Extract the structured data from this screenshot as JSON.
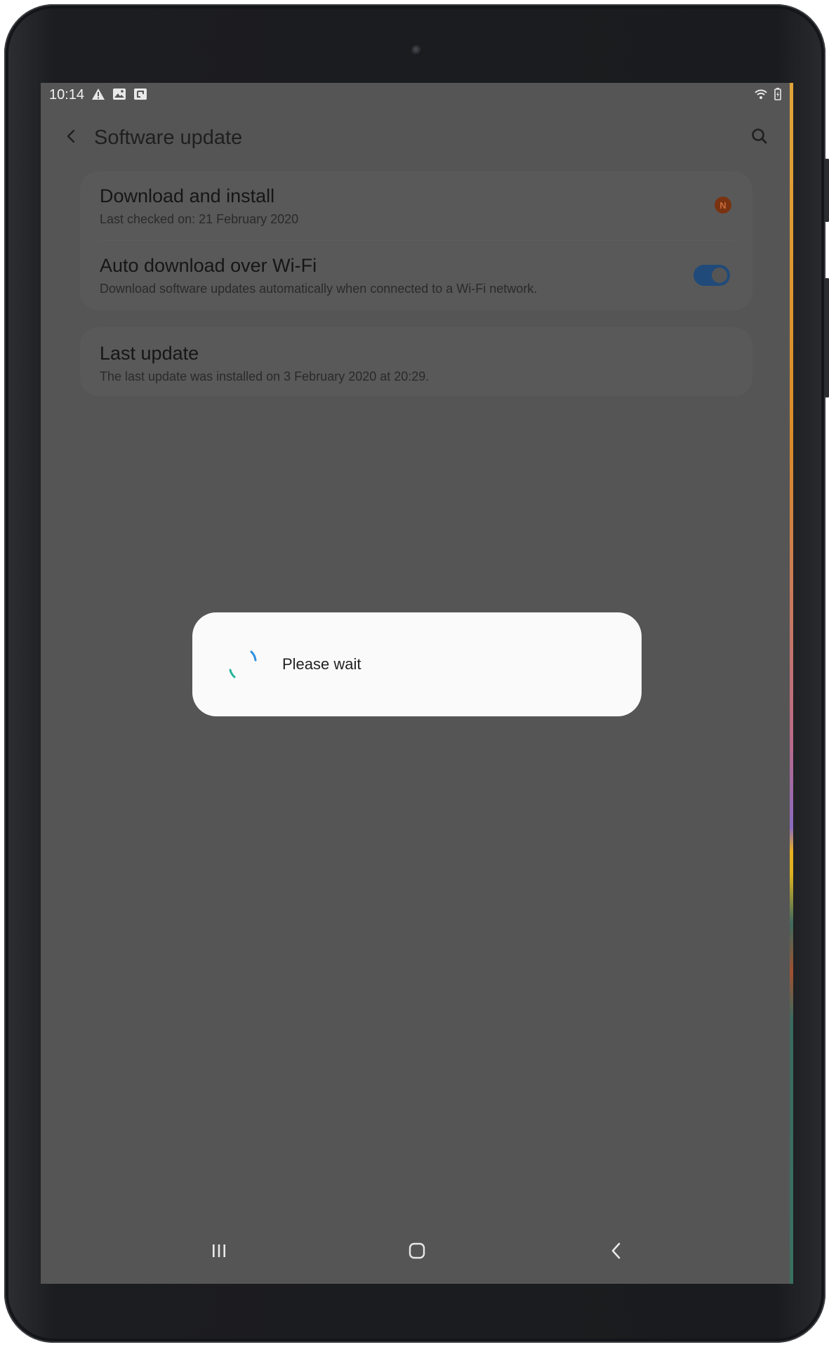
{
  "status_bar": {
    "time": "10:14",
    "left_icons": [
      "warning-icon",
      "image-icon",
      "screenshot-icon"
    ],
    "right_icons": [
      "wifi-icon",
      "battery-icon"
    ]
  },
  "app_bar": {
    "title": "Software update",
    "back_icon": "chevron-left-icon",
    "search_icon": "search-icon"
  },
  "settings": {
    "group1": [
      {
        "title": "Download and install",
        "subtitle": "Last checked on: 21 February 2020",
        "badge": "N"
      },
      {
        "title": "Auto download over Wi-Fi",
        "subtitle": "Download software updates automatically when connected to a Wi-Fi network.",
        "toggle_on": true
      }
    ],
    "group2": [
      {
        "title": "Last update",
        "subtitle": "The last update was installed on 3 February 2020 at 20:29."
      }
    ]
  },
  "dialog": {
    "message": "Please wait"
  },
  "nav_bar": {
    "recents_icon": "recents-icon",
    "home_icon": "home-icon",
    "back_icon": "back-icon"
  },
  "colors": {
    "screen_dim": "#555555",
    "dialog_bg": "#fafafa",
    "toggle_on": "#1f4a7a",
    "badge": "#7a3310",
    "spinner_blue": "#2f8fe0",
    "spinner_teal": "#25b59a"
  }
}
